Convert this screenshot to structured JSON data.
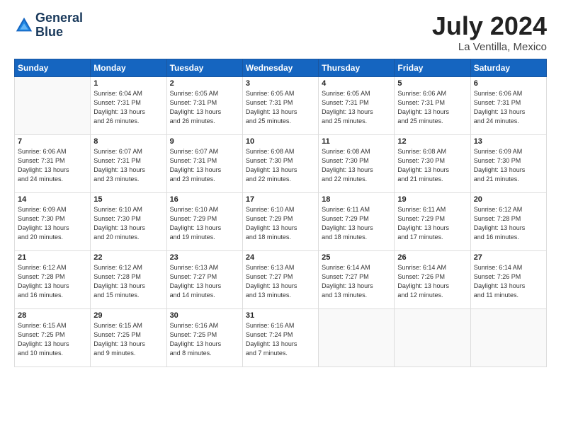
{
  "logo": {
    "line1": "General",
    "line2": "Blue"
  },
  "title": "July 2024",
  "location": "La Ventilla, Mexico",
  "weekdays": [
    "Sunday",
    "Monday",
    "Tuesday",
    "Wednesday",
    "Thursday",
    "Friday",
    "Saturday"
  ],
  "weeks": [
    [
      {
        "day": "",
        "content": ""
      },
      {
        "day": "1",
        "content": "Sunrise: 6:04 AM\nSunset: 7:31 PM\nDaylight: 13 hours\nand 26 minutes."
      },
      {
        "day": "2",
        "content": "Sunrise: 6:05 AM\nSunset: 7:31 PM\nDaylight: 13 hours\nand 26 minutes."
      },
      {
        "day": "3",
        "content": "Sunrise: 6:05 AM\nSunset: 7:31 PM\nDaylight: 13 hours\nand 25 minutes."
      },
      {
        "day": "4",
        "content": "Sunrise: 6:05 AM\nSunset: 7:31 PM\nDaylight: 13 hours\nand 25 minutes."
      },
      {
        "day": "5",
        "content": "Sunrise: 6:06 AM\nSunset: 7:31 PM\nDaylight: 13 hours\nand 25 minutes."
      },
      {
        "day": "6",
        "content": "Sunrise: 6:06 AM\nSunset: 7:31 PM\nDaylight: 13 hours\nand 24 minutes."
      }
    ],
    [
      {
        "day": "7",
        "content": "Sunrise: 6:06 AM\nSunset: 7:31 PM\nDaylight: 13 hours\nand 24 minutes."
      },
      {
        "day": "8",
        "content": "Sunrise: 6:07 AM\nSunset: 7:31 PM\nDaylight: 13 hours\nand 23 minutes."
      },
      {
        "day": "9",
        "content": "Sunrise: 6:07 AM\nSunset: 7:31 PM\nDaylight: 13 hours\nand 23 minutes."
      },
      {
        "day": "10",
        "content": "Sunrise: 6:08 AM\nSunset: 7:30 PM\nDaylight: 13 hours\nand 22 minutes."
      },
      {
        "day": "11",
        "content": "Sunrise: 6:08 AM\nSunset: 7:30 PM\nDaylight: 13 hours\nand 22 minutes."
      },
      {
        "day": "12",
        "content": "Sunrise: 6:08 AM\nSunset: 7:30 PM\nDaylight: 13 hours\nand 21 minutes."
      },
      {
        "day": "13",
        "content": "Sunrise: 6:09 AM\nSunset: 7:30 PM\nDaylight: 13 hours\nand 21 minutes."
      }
    ],
    [
      {
        "day": "14",
        "content": "Sunrise: 6:09 AM\nSunset: 7:30 PM\nDaylight: 13 hours\nand 20 minutes."
      },
      {
        "day": "15",
        "content": "Sunrise: 6:10 AM\nSunset: 7:30 PM\nDaylight: 13 hours\nand 20 minutes."
      },
      {
        "day": "16",
        "content": "Sunrise: 6:10 AM\nSunset: 7:29 PM\nDaylight: 13 hours\nand 19 minutes."
      },
      {
        "day": "17",
        "content": "Sunrise: 6:10 AM\nSunset: 7:29 PM\nDaylight: 13 hours\nand 18 minutes."
      },
      {
        "day": "18",
        "content": "Sunrise: 6:11 AM\nSunset: 7:29 PM\nDaylight: 13 hours\nand 18 minutes."
      },
      {
        "day": "19",
        "content": "Sunrise: 6:11 AM\nSunset: 7:29 PM\nDaylight: 13 hours\nand 17 minutes."
      },
      {
        "day": "20",
        "content": "Sunrise: 6:12 AM\nSunset: 7:28 PM\nDaylight: 13 hours\nand 16 minutes."
      }
    ],
    [
      {
        "day": "21",
        "content": "Sunrise: 6:12 AM\nSunset: 7:28 PM\nDaylight: 13 hours\nand 16 minutes."
      },
      {
        "day": "22",
        "content": "Sunrise: 6:12 AM\nSunset: 7:28 PM\nDaylight: 13 hours\nand 15 minutes."
      },
      {
        "day": "23",
        "content": "Sunrise: 6:13 AM\nSunset: 7:27 PM\nDaylight: 13 hours\nand 14 minutes."
      },
      {
        "day": "24",
        "content": "Sunrise: 6:13 AM\nSunset: 7:27 PM\nDaylight: 13 hours\nand 13 minutes."
      },
      {
        "day": "25",
        "content": "Sunrise: 6:14 AM\nSunset: 7:27 PM\nDaylight: 13 hours\nand 13 minutes."
      },
      {
        "day": "26",
        "content": "Sunrise: 6:14 AM\nSunset: 7:26 PM\nDaylight: 13 hours\nand 12 minutes."
      },
      {
        "day": "27",
        "content": "Sunrise: 6:14 AM\nSunset: 7:26 PM\nDaylight: 13 hours\nand 11 minutes."
      }
    ],
    [
      {
        "day": "28",
        "content": "Sunrise: 6:15 AM\nSunset: 7:25 PM\nDaylight: 13 hours\nand 10 minutes."
      },
      {
        "day": "29",
        "content": "Sunrise: 6:15 AM\nSunset: 7:25 PM\nDaylight: 13 hours\nand 9 minutes."
      },
      {
        "day": "30",
        "content": "Sunrise: 6:16 AM\nSunset: 7:25 PM\nDaylight: 13 hours\nand 8 minutes."
      },
      {
        "day": "31",
        "content": "Sunrise: 6:16 AM\nSunset: 7:24 PM\nDaylight: 13 hours\nand 7 minutes."
      },
      {
        "day": "",
        "content": ""
      },
      {
        "day": "",
        "content": ""
      },
      {
        "day": "",
        "content": ""
      }
    ]
  ]
}
